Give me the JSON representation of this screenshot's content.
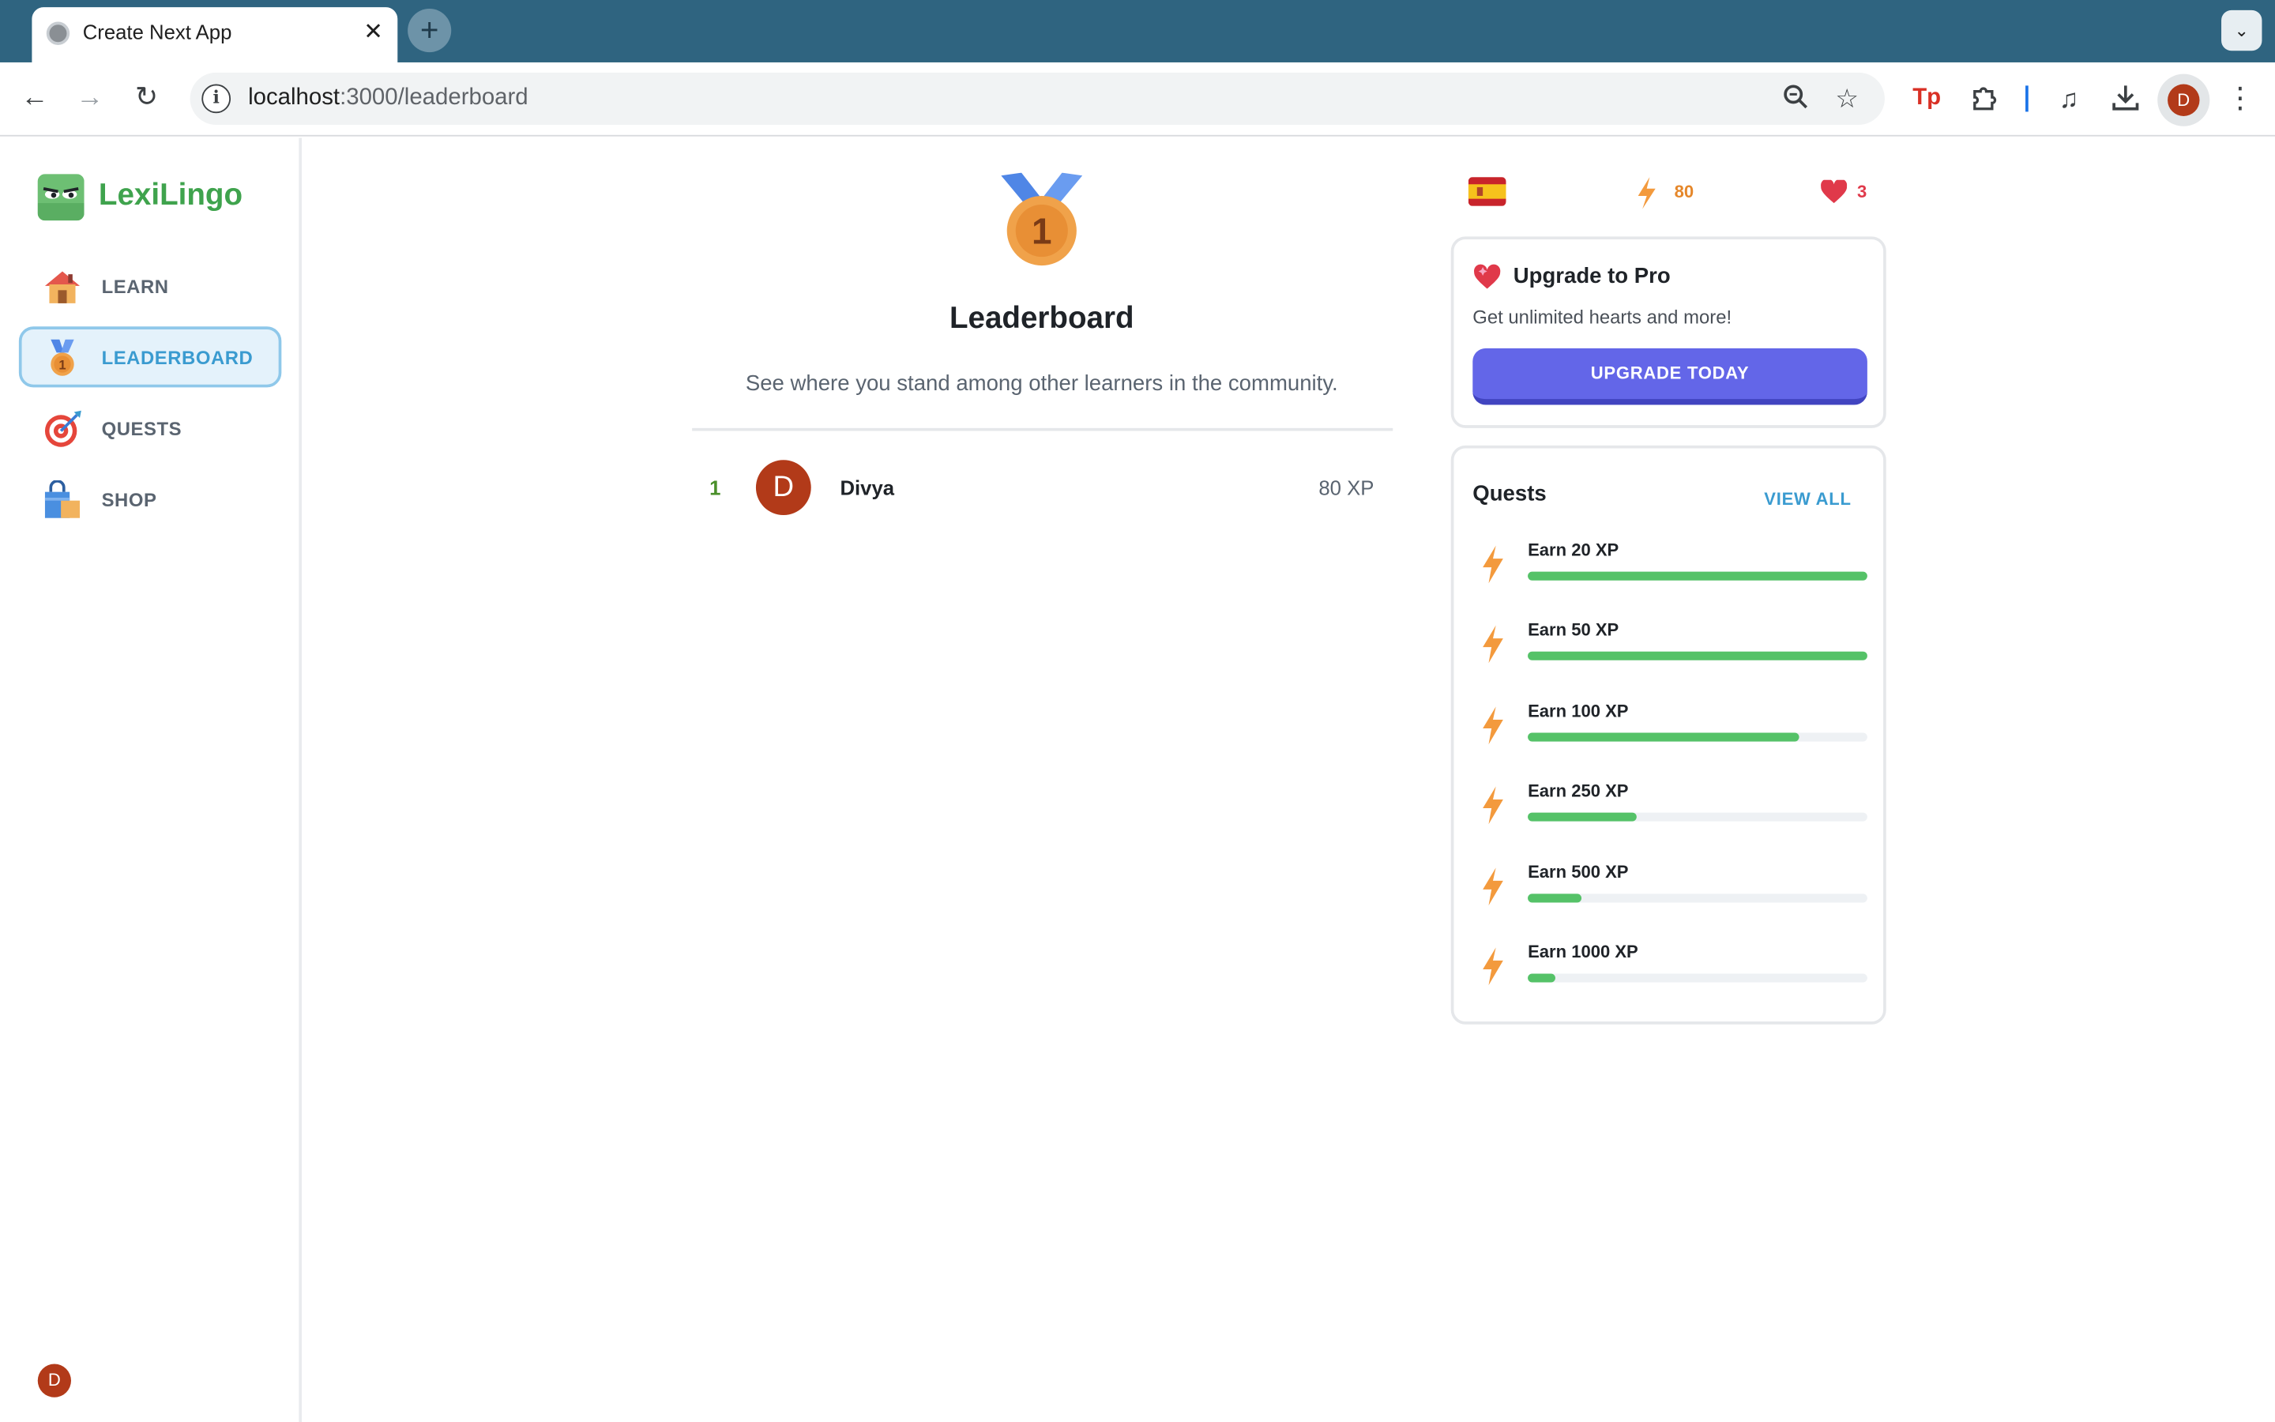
{
  "browser": {
    "tab_title": "Create Next App",
    "url_host": "localhost",
    "url_path": ":3000/leaderboard",
    "profile_initial": "D"
  },
  "brand": {
    "name": "LexiLingo",
    "color": "#3fa34d"
  },
  "sidebar": {
    "items": [
      {
        "label": "LEARN",
        "icon": "house-icon",
        "active": false
      },
      {
        "label": "LEADERBOARD",
        "icon": "medal-icon",
        "active": true
      },
      {
        "label": "QUESTS",
        "icon": "target-icon",
        "active": false
      },
      {
        "label": "SHOP",
        "icon": "shopping-bag-icon",
        "active": false
      }
    ],
    "user_initial": "D"
  },
  "leaderboard": {
    "medal_number": "1",
    "title": "Leaderboard",
    "subtitle": "See where you stand among other learners in the community.",
    "entries": [
      {
        "rank": "1",
        "initial": "D",
        "name": "Divya",
        "xp": "80 XP"
      }
    ]
  },
  "stats": {
    "language_flag": "spain-flag-icon",
    "xp": "80",
    "hearts": "3"
  },
  "pro": {
    "title": "Upgrade to Pro",
    "subtitle": "Get unlimited hearts and more!",
    "button": "UPGRADE TODAY"
  },
  "quests": {
    "title": "Quests",
    "view_all": "VIEW ALL",
    "items": [
      {
        "label": "Earn 20 XP",
        "progress": 1.0
      },
      {
        "label": "Earn 50 XP",
        "progress": 1.0
      },
      {
        "label": "Earn 100 XP",
        "progress": 0.8
      },
      {
        "label": "Earn 250 XP",
        "progress": 0.32
      },
      {
        "label": "Earn 500 XP",
        "progress": 0.16
      },
      {
        "label": "Earn 1000 XP",
        "progress": 0.08
      }
    ]
  },
  "colors": {
    "accent_blue": "#3a9bd0",
    "xp_orange": "#e5872a",
    "heart_red": "#e0394a",
    "button_purple": "#6366e8",
    "progress_green": "#55c268"
  }
}
